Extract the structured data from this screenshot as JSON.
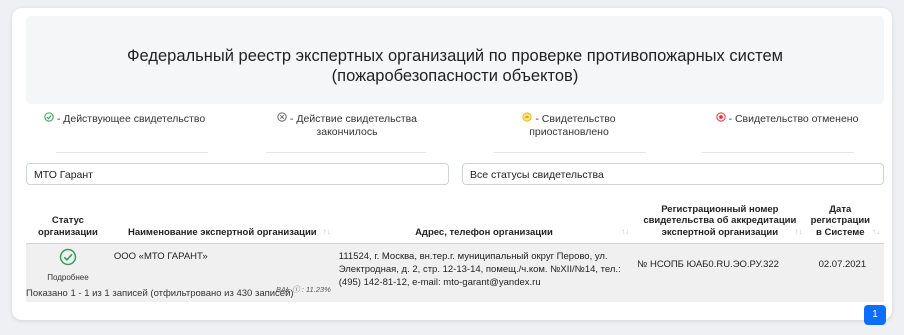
{
  "header": {
    "title_line1": "Федеральный реестр экспертных организаций по проверке противопожарных систем",
    "title_line2": "(пожаробезопасности объектов)"
  },
  "legend": [
    {
      "icon": "check-circle-icon",
      "color": "#2e9e57",
      "label": "- Действующее свидетельство"
    },
    {
      "icon": "x-circle-icon",
      "color": "#666666",
      "label": "- Действие свидетельства закончилось"
    },
    {
      "icon": "pause-circle-icon",
      "color": "#e6b800",
      "label": "- Свидетельство приостановлено"
    },
    {
      "icon": "stop-circle-icon",
      "color": "#dc3545",
      "label": "- Свидетельство отменено"
    }
  ],
  "filters": {
    "search_value": "МТО Гарант",
    "status_value": "Все статусы свидетельства"
  },
  "table": {
    "columns": [
      "Статус организации",
      "Наименование экспертной организации",
      "Адрес, телефон организации",
      "Регистрационный номер свидетельства об аккредитации экспертной организации",
      "Дата регистрации в Системе"
    ],
    "rows": [
      {
        "status_icon": "check-circle-icon",
        "status_link": "Подробнее",
        "name": "ООО «МТО ГАРАНТ»",
        "bal_label": "BAL",
        "bal_value": ": 11.23%",
        "address": "111524, г. Москва, вн.тер.г. муниципальный округ Перово, ул. Электродная, д. 2, стр. 12-13-14, помещ./ч.ком. №XII/№14, тел.: (495) 142-81-12, e-mail: mto-garant@yandex.ru",
        "reg_number": "№ НСОПБ ЮАБ0.RU.ЭО.РУ.322",
        "date": "02.07.2021"
      }
    ]
  },
  "footer": {
    "info": "Показано 1 - 1 из 1 записей (отфильтровано из 430 записей)",
    "page": "1"
  },
  "colors": {
    "accent": "#0d6efd",
    "active": "#2e9e57",
    "suspended": "#e6b800",
    "revoked": "#dc3545"
  }
}
